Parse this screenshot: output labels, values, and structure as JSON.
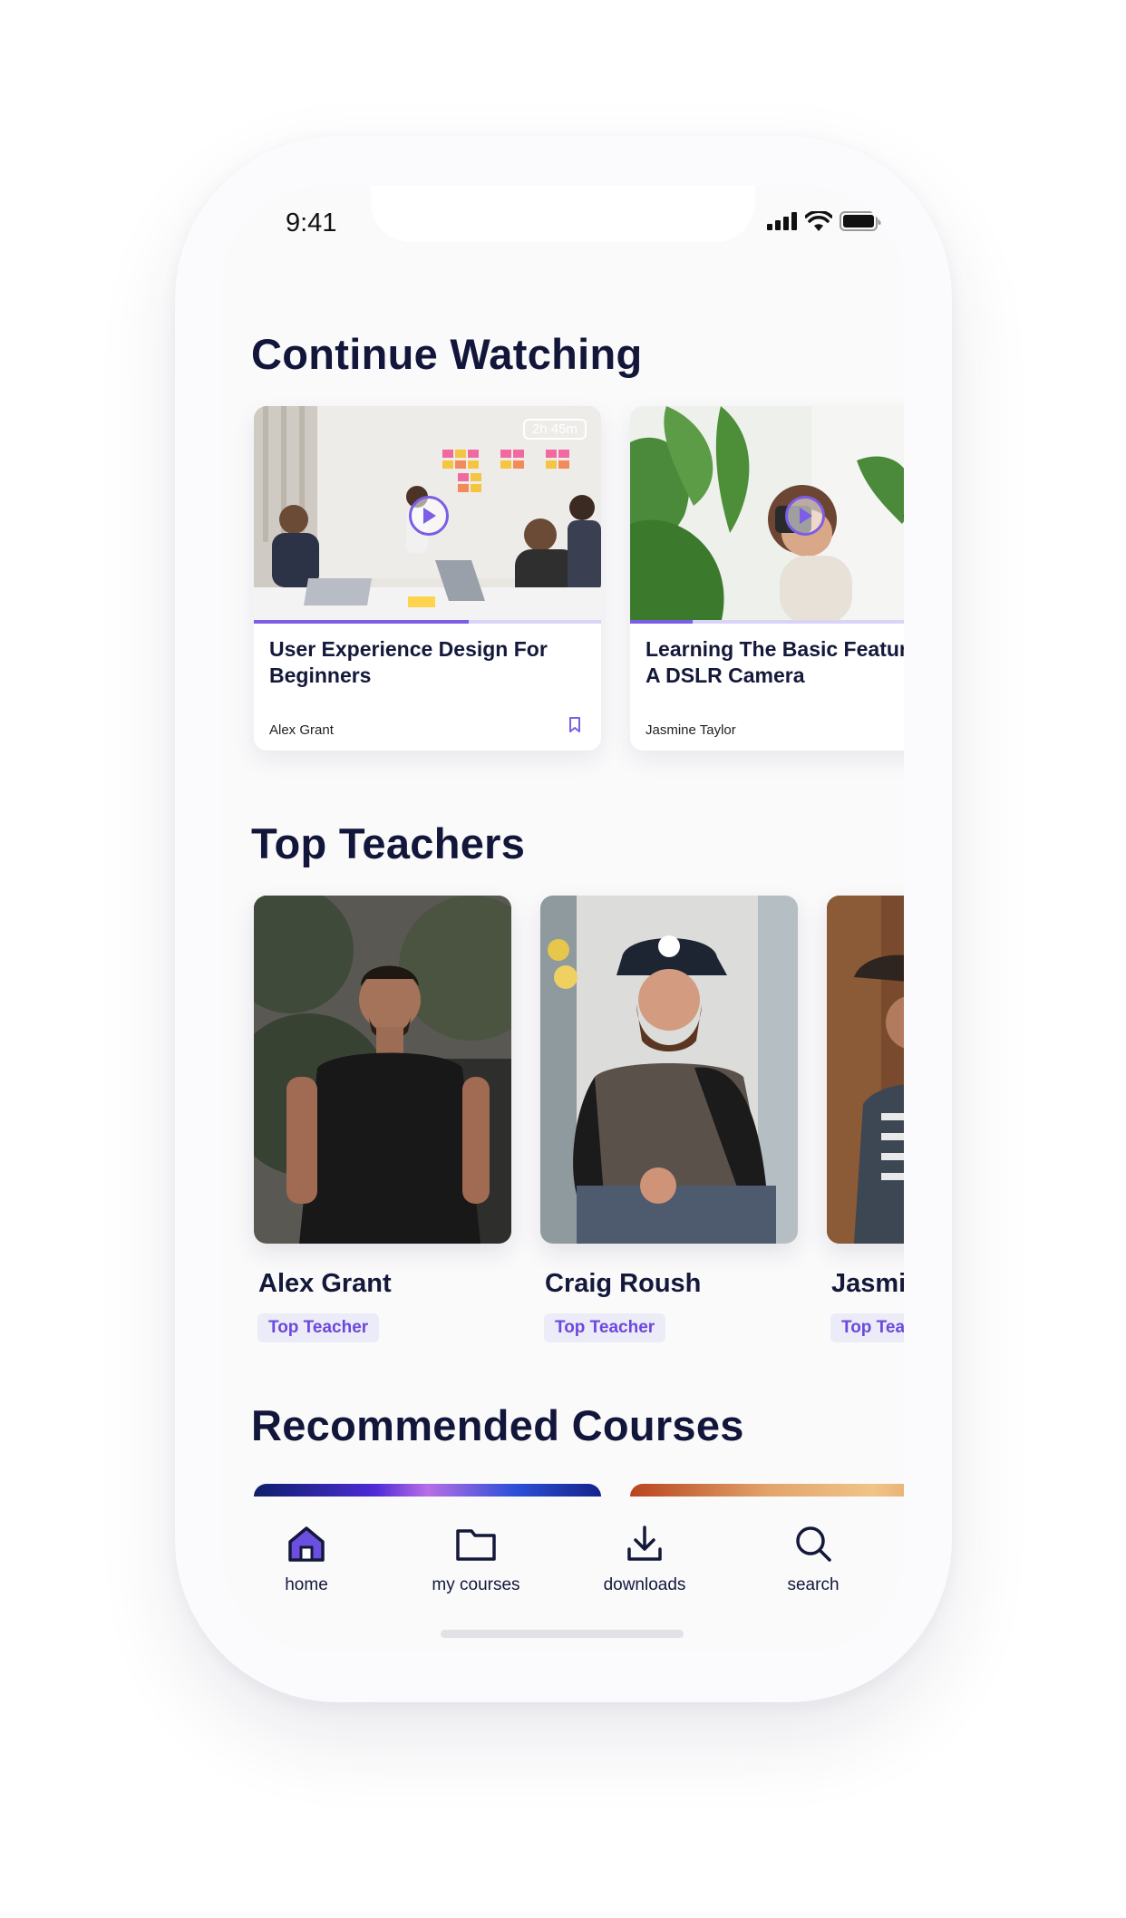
{
  "status_bar": {
    "time": "9:41"
  },
  "sections": {
    "continue_watching": "Continue Watching",
    "top_teachers": "Top Teachers",
    "recommended_courses": "Recommended Courses"
  },
  "continue_watching": [
    {
      "title": "User Experience Design For\nBeginners",
      "author": "Alex Grant",
      "duration": "2h 45m",
      "progress": 0.62,
      "bookmark_icon": "bookmark-icon"
    },
    {
      "title": "Learning The Basic Features of\nA DSLR Camera",
      "author": "Jasmine Taylor",
      "duration": "",
      "progress": 0.18
    }
  ],
  "top_teachers": [
    {
      "name": "Alex Grant",
      "badge": "Top Teacher"
    },
    {
      "name": "Craig Roush",
      "badge": "Top Teacher"
    },
    {
      "name": "Jasmine",
      "badge": "Top Teacher"
    }
  ],
  "tabs": [
    {
      "label": "home",
      "icon": "home-icon",
      "active": true
    },
    {
      "label": "my courses",
      "icon": "folder-icon",
      "active": false
    },
    {
      "label": "downloads",
      "icon": "download-icon",
      "active": false
    },
    {
      "label": "search",
      "icon": "search-icon",
      "active": false
    }
  ],
  "colors": {
    "accent": "#7b5de6",
    "title": "#12163a",
    "badge_bg": "#ecebf8",
    "badge_text": "#6b49dc"
  }
}
